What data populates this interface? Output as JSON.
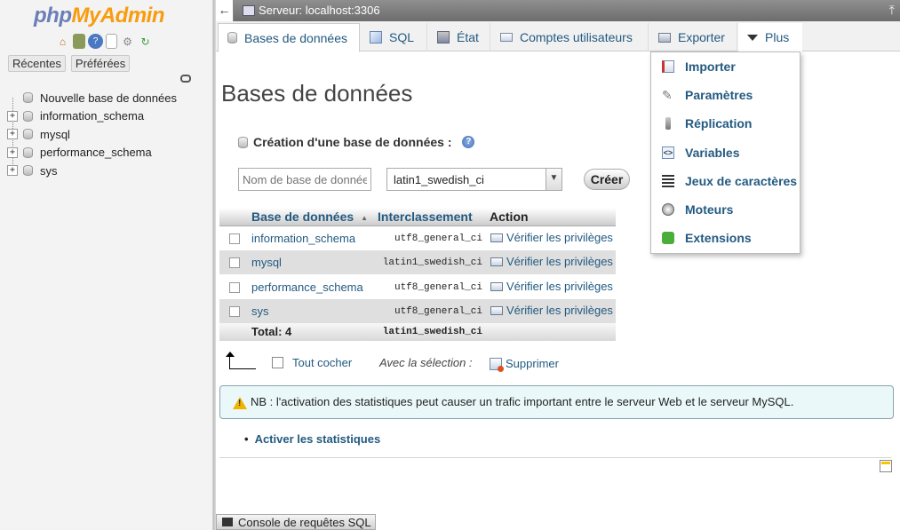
{
  "nav": {
    "logo_php": "php",
    "logo_myadmin": "MyAdmin",
    "icons": [
      "home-icon",
      "logout-icon",
      "help-icon",
      "docs-icon",
      "settings-icon",
      "reload-icon"
    ],
    "tabs": {
      "recent": "Récentes",
      "favorites": "Préférées"
    },
    "tree": {
      "new_db": "Nouvelle base de données",
      "databases": [
        "information_schema",
        "mysql",
        "performance_schema",
        "sys"
      ]
    }
  },
  "topbar": {
    "back": "←",
    "server": "Serveur: localhost:3306",
    "collapse": "⤒"
  },
  "tabs": [
    {
      "label": "Bases de données",
      "icon": "database-icon",
      "active": true
    },
    {
      "label": "SQL",
      "icon": "sql-icon"
    },
    {
      "label": "État",
      "icon": "status-icon"
    },
    {
      "label": "Comptes utilisateurs",
      "icon": "users-icon"
    },
    {
      "label": "Exporter",
      "icon": "export-icon"
    },
    {
      "label": "Plus",
      "icon": "triangle-down-icon"
    }
  ],
  "dropdown": [
    {
      "label": "Importer",
      "icon": "import-icon"
    },
    {
      "label": "Paramètres",
      "icon": "wrench-icon"
    },
    {
      "label": "Réplication",
      "icon": "replication-icon"
    },
    {
      "label": "Variables",
      "icon": "variables-icon"
    },
    {
      "label": "Jeux de caractères",
      "icon": "charset-icon"
    },
    {
      "label": "Moteurs",
      "icon": "engines-icon"
    },
    {
      "label": "Extensions",
      "icon": "puzzle-icon"
    }
  ],
  "main": {
    "title": "Bases de données",
    "create": {
      "label": "Création d'une base de données :",
      "help": "?",
      "placeholder": "Nom de base de données",
      "collation": "latin1_swedish_ci",
      "button": "Créer"
    },
    "table": {
      "headers": {
        "name": "Base de données",
        "collation": "Interclassement",
        "action": "Action"
      },
      "rows": [
        {
          "name": "information_schema",
          "collation": "utf8_general_ci",
          "action": "Vérifier les privilèges"
        },
        {
          "name": "mysql",
          "collation": "latin1_swedish_ci",
          "action": "Vérifier les privilèges"
        },
        {
          "name": "performance_schema",
          "collation": "utf8_general_ci",
          "action": "Vérifier les privilèges"
        },
        {
          "name": "sys",
          "collation": "utf8_general_ci",
          "action": "Vérifier les privilèges"
        }
      ],
      "total": {
        "label": "Total: 4",
        "collation": "latin1_swedish_ci"
      }
    },
    "bulk": {
      "check_all": "Tout cocher",
      "with_selection": "Avec la sélection :",
      "delete": "Supprimer"
    },
    "notice": "NB : l'activation des statistiques peut causer un trafic important entre le serveur Web et le serveur MySQL.",
    "stats_link": "Activer les statistiques"
  },
  "console": {
    "label": "Console de requêtes SQL"
  },
  "colors": {
    "link": "#235a81",
    "logo_php": "#6c7eb7",
    "logo_myadmin": "#f89c0e",
    "notice_bg": "#ebf8fa"
  }
}
